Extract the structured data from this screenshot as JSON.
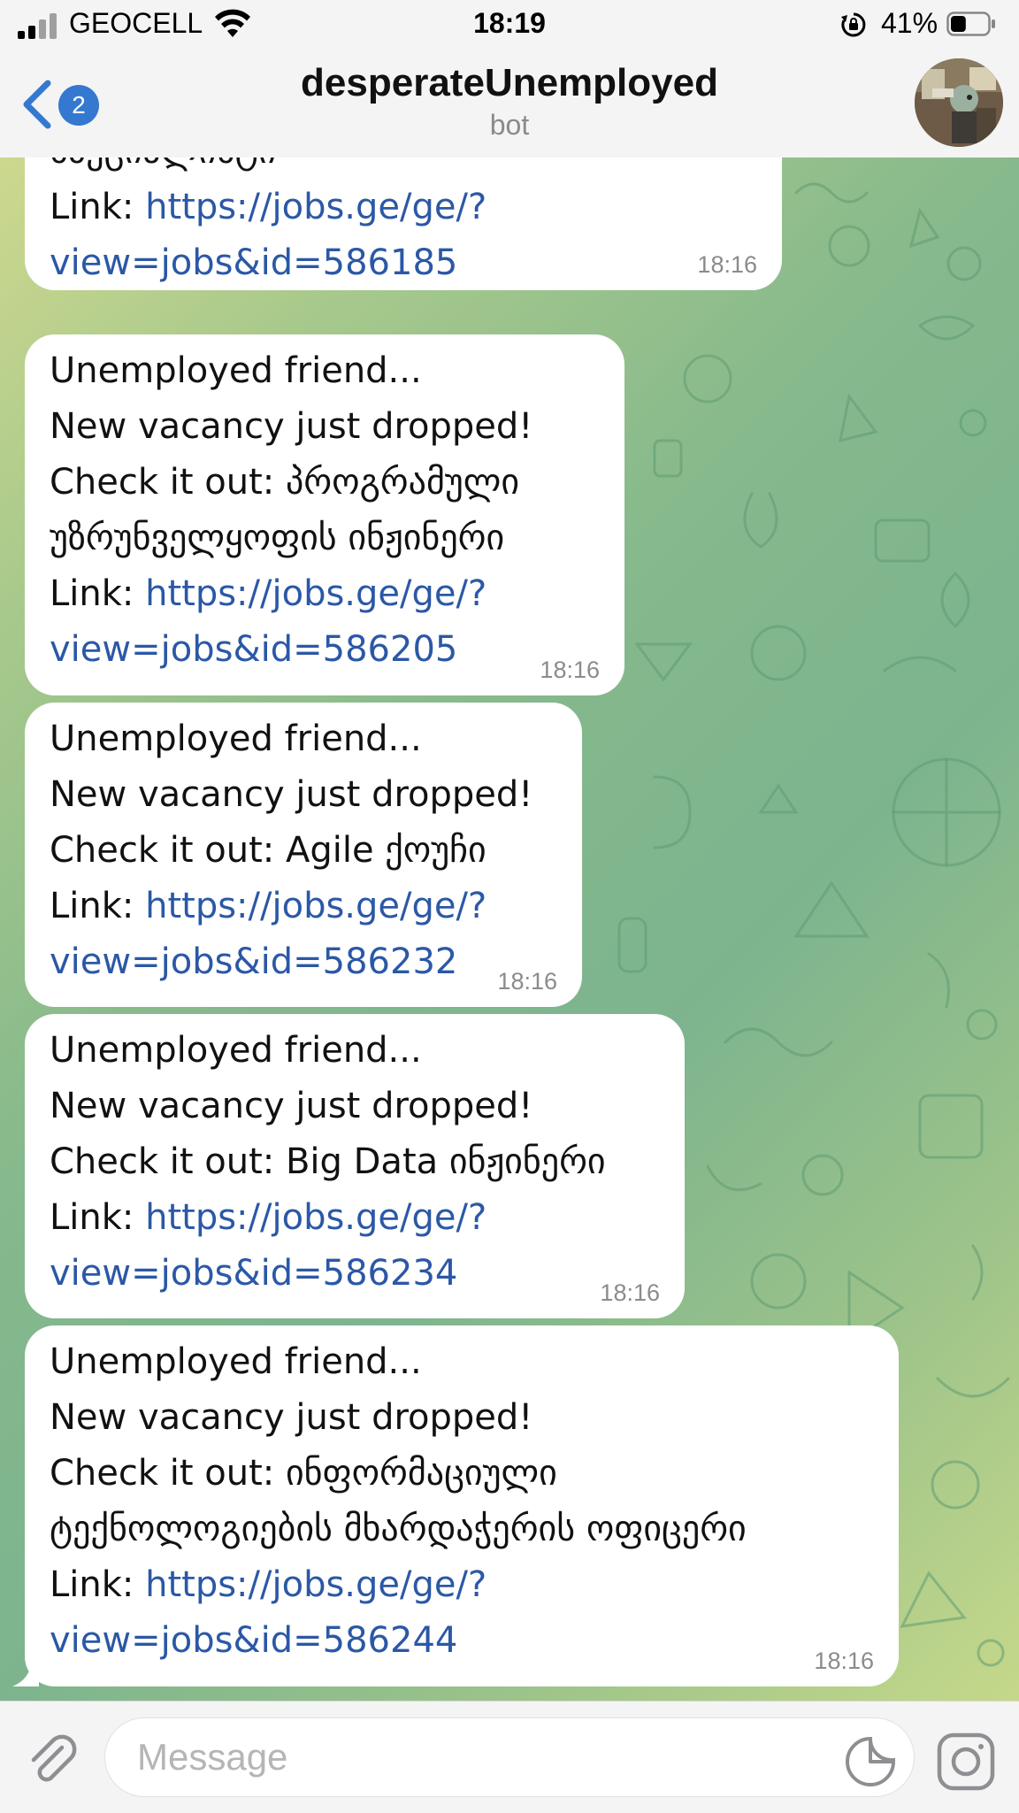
{
  "status_bar": {
    "carrier": "GEOCELL",
    "time": "18:19",
    "battery_percent": "41%",
    "battery_level": 0.41
  },
  "header": {
    "back_badge": "2",
    "title": "desperateUnemployed",
    "subtitle": "bot"
  },
  "messages": [
    {
      "lines": [
        {
          "text": "სპეციალისტი"
        },
        {
          "prefix": "Link: ",
          "link": "https://jobs.ge/ge/?"
        },
        {
          "link": "view=jobs&id=586185"
        }
      ],
      "time": "18:16"
    },
    {
      "lines": [
        {
          "text": "Unemployed friend..."
        },
        {
          "text": "New vacancy just dropped!"
        },
        {
          "text": "Check it out: პროგრამული"
        },
        {
          "text": "უზრუნველყოფის ინჟინერი"
        },
        {
          "prefix": "Link: ",
          "link": "https://jobs.ge/ge/?"
        },
        {
          "link": "view=jobs&id=586205"
        }
      ],
      "time": "18:16"
    },
    {
      "lines": [
        {
          "text": "Unemployed friend..."
        },
        {
          "text": "New vacancy just dropped!"
        },
        {
          "text": "Check it out: Agile ქოუჩი"
        },
        {
          "prefix": "Link: ",
          "link": "https://jobs.ge/ge/?"
        },
        {
          "link": "view=jobs&id=586232"
        }
      ],
      "time": "18:16"
    },
    {
      "lines": [
        {
          "text": "Unemployed friend..."
        },
        {
          "text": "New vacancy just dropped!"
        },
        {
          "text": "Check it out: Big Data ინჟინერი"
        },
        {
          "prefix": "Link: ",
          "link": "https://jobs.ge/ge/?"
        },
        {
          "link": "view=jobs&id=586234"
        }
      ],
      "time": "18:16"
    },
    {
      "lines": [
        {
          "text": "Unemployed friend..."
        },
        {
          "text": "New vacancy just dropped!"
        },
        {
          "text": "Check it out: ინფორმაციული"
        },
        {
          "text": "ტექნოლოგიების მხარდაჭერის ოფიცერი"
        },
        {
          "prefix": "Link: ",
          "link": "https://jobs.ge/ge/?"
        },
        {
          "link": "view=jobs&id=586244"
        }
      ],
      "time": "18:16"
    }
  ],
  "input": {
    "placeholder": "Message"
  },
  "icons": {
    "back": "chevron-left-icon",
    "attach": "paperclip-icon",
    "sticker": "sticker-icon",
    "camera": "camera-icon"
  },
  "colors": {
    "link": "#2b58a6",
    "accent": "#3478d0",
    "bubble": "#ffffff"
  }
}
